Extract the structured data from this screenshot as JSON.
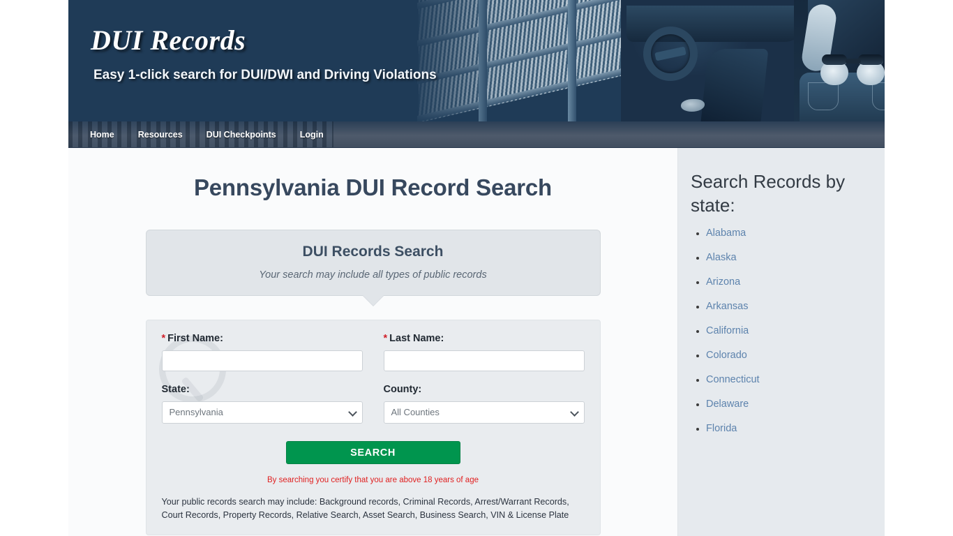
{
  "header": {
    "site_title": "DUI Records",
    "tagline": "Easy 1-click search for DUI/DWI and Driving Violations",
    "bg_color": "#1f3b57"
  },
  "nav": {
    "items": [
      {
        "label": "Home"
      },
      {
        "label": "Resources"
      },
      {
        "label": "DUI Checkpoints"
      },
      {
        "label": "Login"
      }
    ]
  },
  "main": {
    "page_title": "Pennsylvania DUI Record Search",
    "callout": {
      "title": "DUI Records Search",
      "subtitle": "Your search may include all types of public records"
    },
    "form": {
      "first_name": {
        "label": "First Name:",
        "required_marker": "*",
        "value": "",
        "placeholder": ""
      },
      "last_name": {
        "label": "Last Name:",
        "required_marker": "*",
        "value": "",
        "placeholder": ""
      },
      "state": {
        "label": "State:",
        "selected": "Pennsylvania"
      },
      "county": {
        "label": "County:",
        "selected": "All Counties"
      },
      "submit_label": "SEARCH",
      "certify_text": "By searching you certify that you are above 18 years of age",
      "disclaimer": "Your public records search may include: Background records, Criminal Records, Arrest/Warrant Records, Court Records, Property Records, Relative Search, Asset Search, Business Search, VIN & License Plate"
    }
  },
  "sidebar": {
    "title": "Search Records by state:",
    "states": [
      {
        "label": "Alabama"
      },
      {
        "label": "Alaska"
      },
      {
        "label": "Arizona"
      },
      {
        "label": "Arkansas"
      },
      {
        "label": "California"
      },
      {
        "label": "Colorado"
      },
      {
        "label": "Connecticut"
      },
      {
        "label": "Delaware"
      },
      {
        "label": "Florida"
      }
    ],
    "link_color": "#5d83ad"
  },
  "colors": {
    "header_navy": "#1f3b57",
    "nav_gray": "#4e5a6b",
    "search_green": "#00954e",
    "certify_red": "#e02020",
    "title_slate": "#37485e"
  }
}
